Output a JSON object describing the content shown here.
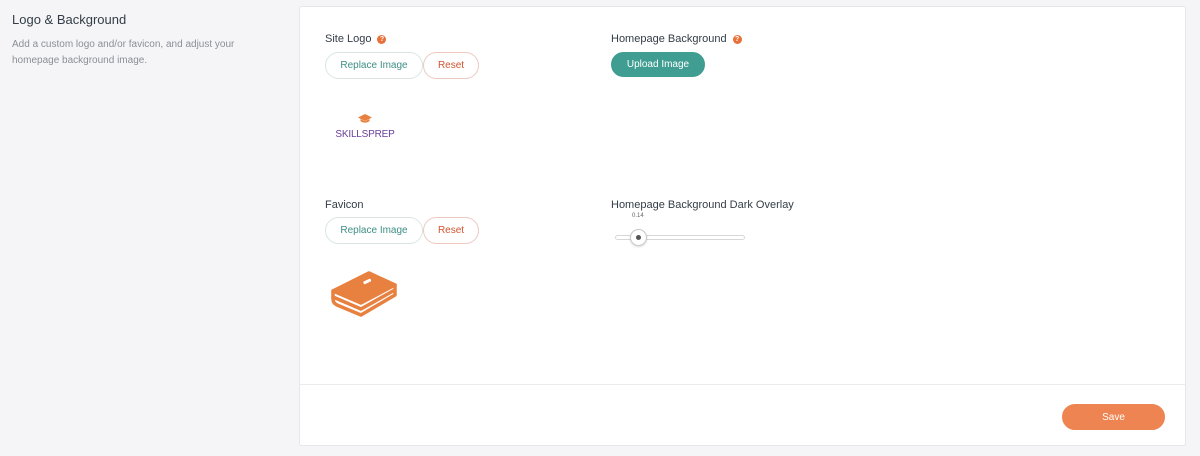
{
  "section": {
    "title": "Logo & Background",
    "description": "Add a custom logo and/or favicon, and adjust your homepage background image."
  },
  "site_logo": {
    "label": "Site Logo",
    "help_icon": "help-icon",
    "replace_label": "Replace Image",
    "reset_label": "Reset",
    "logo_text": "SKILLSPREP"
  },
  "favicon": {
    "label": "Favicon",
    "replace_label": "Replace Image",
    "reset_label": "Reset",
    "icon": "book-icon"
  },
  "homepage_background": {
    "label": "Homepage Background",
    "help_icon": "help-icon",
    "upload_label": "Upload Image"
  },
  "dark_overlay": {
    "label": "Homepage Background Dark Overlay",
    "value": "0.14"
  },
  "footer": {
    "save_label": "Save"
  },
  "colors": {
    "accent_teal": "#3f9d91",
    "accent_orange": "#ee8451",
    "reset_red": "#d0542f",
    "logo_purple": "#6a3f99"
  }
}
